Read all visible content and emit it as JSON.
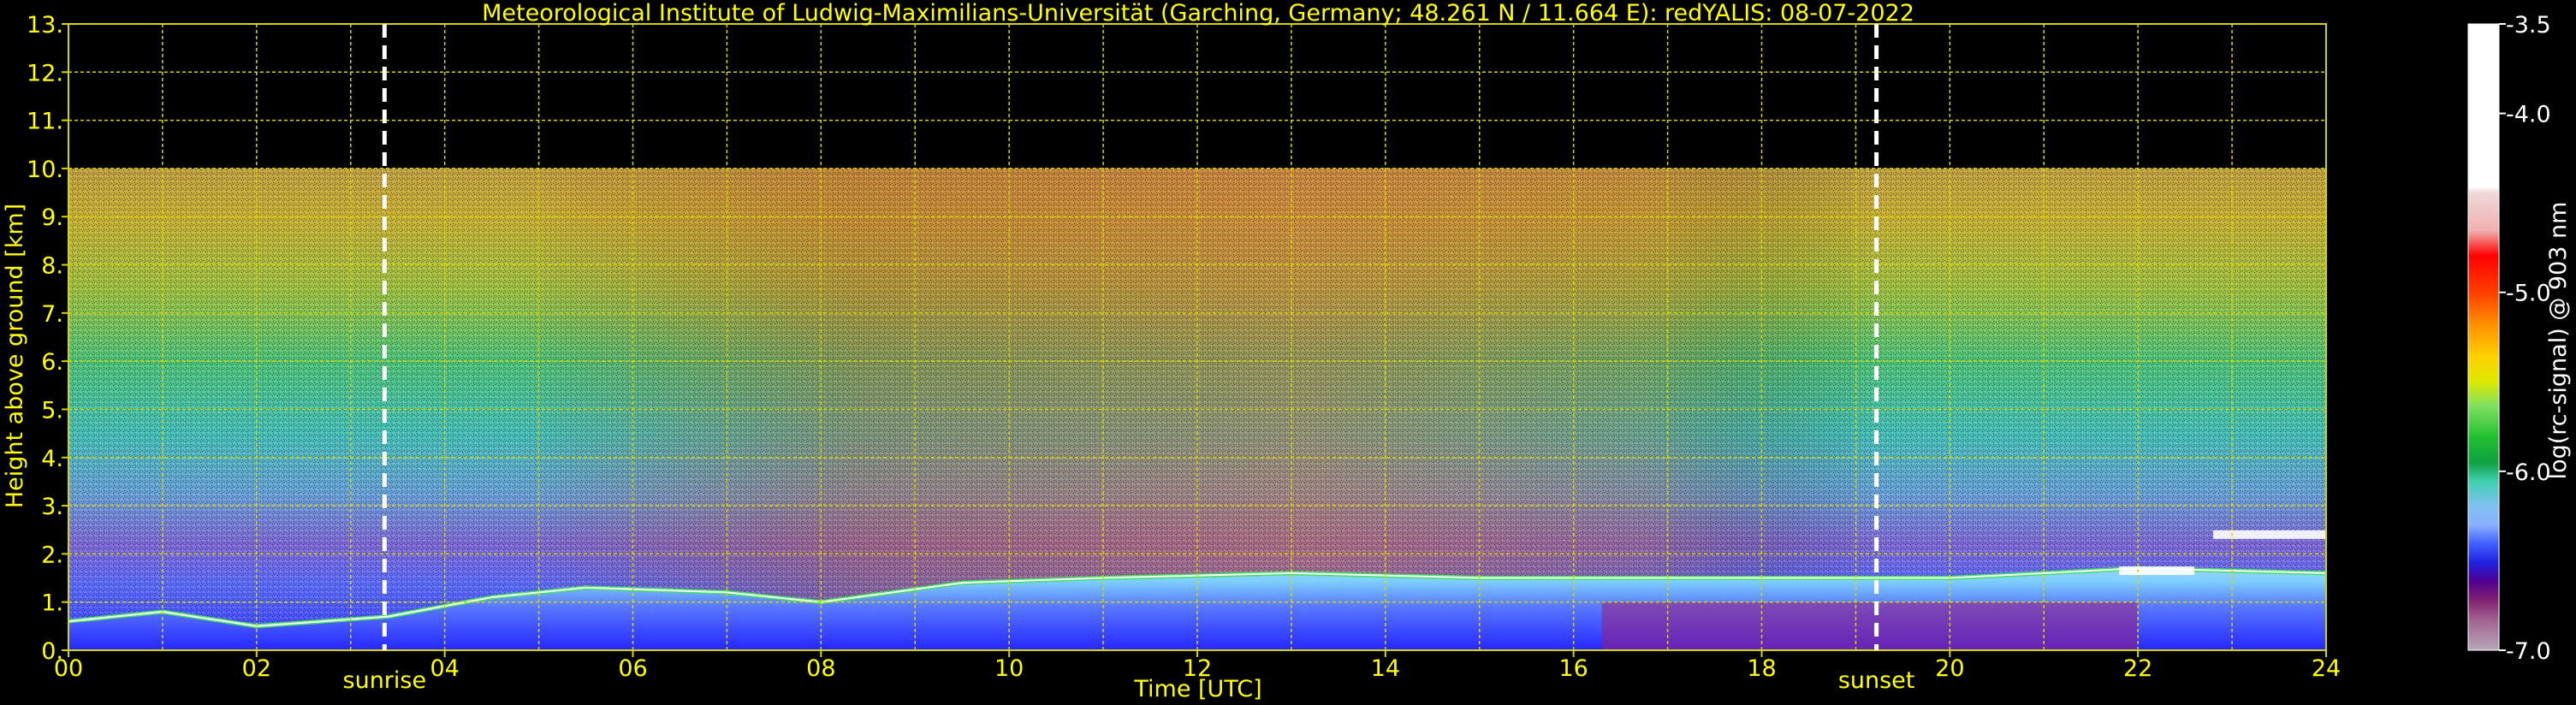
{
  "chart_data": {
    "type": "heatmap",
    "title": "Meteorological Institute of Ludwig-Maximilians-Universität (Garching, Germany; 48.261 N / 11.664 E):    redYALIS: 08-07-2022",
    "xlabel": "Time [UTC]",
    "ylabel": "Height above ground [km]",
    "xlim": [
      0,
      24
    ],
    "ylim": [
      0,
      13
    ],
    "x_ticks": [
      "00",
      "02",
      "04",
      "06",
      "08",
      "10",
      "12",
      "14",
      "16",
      "18",
      "20",
      "22",
      "24"
    ],
    "y_ticks": [
      "0.",
      "1.",
      "2.",
      "3.",
      "4.",
      "5.",
      "6.",
      "7.",
      "8.",
      "9.",
      "10.",
      "11.",
      "12.",
      "13."
    ],
    "grid": true,
    "data_top_km": 10,
    "events": [
      {
        "label": "sunrise",
        "time": 3.36
      },
      {
        "label": "sunset",
        "time": 19.22
      }
    ],
    "colorbar": {
      "label": "log(rc-signal) @ 903 nm",
      "ticks": [
        "-3.5",
        "-4.0",
        "-5.0",
        "-6.0",
        "-7.0"
      ],
      "tick_values": [
        -3.5,
        -4.0,
        -5.0,
        -6.0,
        -7.0
      ],
      "range": [
        -7.0,
        -3.5
      ]
    },
    "boundary_layer_top_km": [
      {
        "time": 0.0,
        "height": 0.6
      },
      {
        "time": 1.0,
        "height": 0.8
      },
      {
        "time": 2.0,
        "height": 0.5
      },
      {
        "time": 3.4,
        "height": 0.7
      },
      {
        "time": 4.5,
        "height": 1.1
      },
      {
        "time": 5.5,
        "height": 1.3
      },
      {
        "time": 7.0,
        "height": 1.2
      },
      {
        "time": 8.0,
        "height": 1.0
      },
      {
        "time": 9.5,
        "height": 1.4
      },
      {
        "time": 11.0,
        "height": 1.5
      },
      {
        "time": 13.0,
        "height": 1.6
      },
      {
        "time": 15.0,
        "height": 1.5
      },
      {
        "time": 16.0,
        "height": 1.5
      },
      {
        "time": 18.0,
        "height": 1.5
      },
      {
        "time": 20.0,
        "height": 1.5
      },
      {
        "time": 22.0,
        "height": 1.7
      },
      {
        "time": 24.0,
        "height": 1.6
      }
    ],
    "cloud_layers": [
      {
        "start": 21.8,
        "end": 22.6,
        "height": 1.65
      },
      {
        "start": 22.8,
        "end": 24.0,
        "height": 2.4
      }
    ],
    "colors": {
      "axis_text": "#ffff00",
      "grid": "#d4d400",
      "event_line": "#ffffff",
      "background": "#000000"
    }
  }
}
